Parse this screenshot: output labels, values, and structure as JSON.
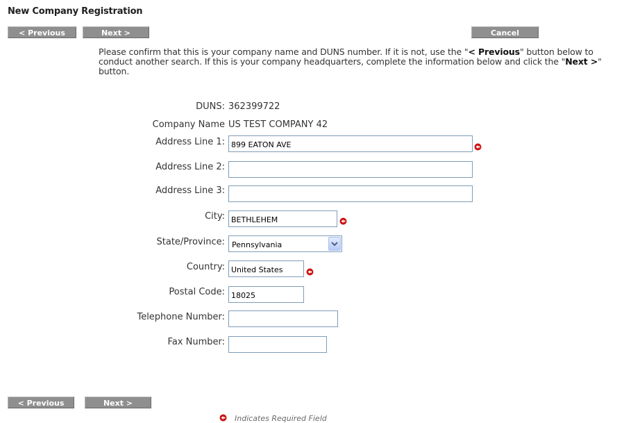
{
  "page": {
    "title": "New Company Registration"
  },
  "nav": {
    "previous_label": "< Previous",
    "next_label": "Next >",
    "cancel_label": "Cancel"
  },
  "intro": {
    "part1": "Please confirm that this is your company name and DUNS number. If it is not, use the \"",
    "previous_ref": "< Previous",
    "part2": "\" button below to conduct another search. If this is your company headquarters, complete the information below and click the \"",
    "next_ref": "Next >",
    "part3": "\" button."
  },
  "form": {
    "duns_label": "DUNS:",
    "duns_value": "362399722",
    "company_name_label": "Company Name",
    "company_name_value": "US TEST COMPANY 42",
    "address1_label": "Address Line 1:",
    "address1_value": "899 EATON AVE",
    "address2_label": "Address Line 2:",
    "address2_value": "",
    "address3_label": "Address Line 3:",
    "address3_value": "",
    "city_label": "City:",
    "city_value": "BETHLEHEM",
    "state_label": "State/Province:",
    "state_value": "Pennsylvania",
    "country_label": "Country:",
    "country_value": "United States",
    "postal_label": "Postal Code:",
    "postal_value": "18025",
    "phone_label": "Telephone Number:",
    "phone_value": "",
    "fax_label": "Fax Number:",
    "fax_value": ""
  },
  "footer": {
    "required_note": "Indicates Required Field"
  },
  "icons": {
    "required": "required-field-icon",
    "dropdown": "chevron-down-icon"
  },
  "colors": {
    "button_bg": "#8f8f8f",
    "required_icon": "#cc1111",
    "input_border": "#7f9db9"
  }
}
